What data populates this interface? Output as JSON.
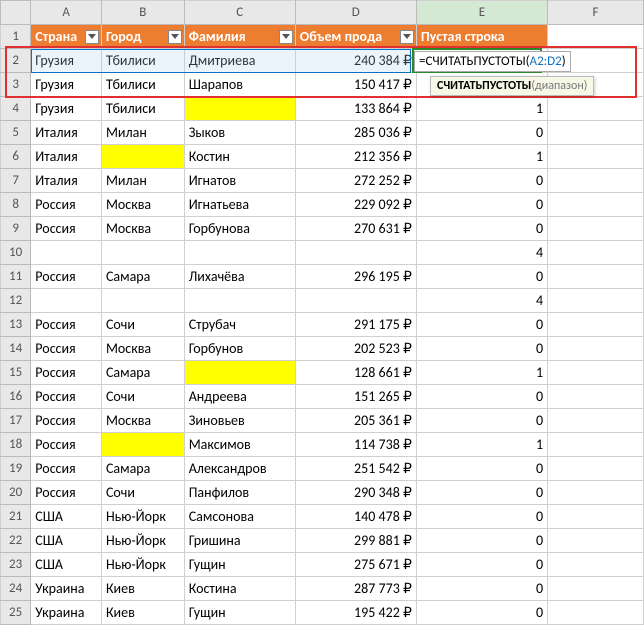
{
  "columns": [
    "A",
    "B",
    "C",
    "D",
    "E",
    "F"
  ],
  "headers": {
    "A": "Страна",
    "B": "Город",
    "C": "Фамилия",
    "D": "Объем прода",
    "E": "Пустая строка"
  },
  "rows": [
    {
      "n": 2,
      "A": "Грузия",
      "B": "Тбилиси",
      "C": "Дмитриева",
      "D": "240 384 ₽",
      "E": ""
    },
    {
      "n": 3,
      "A": "Грузия",
      "B": "Тбилиси",
      "C": "Шарапов",
      "D": "150 417 ₽",
      "E": ""
    },
    {
      "n": 4,
      "A": "Грузия",
      "B": "Тбилиси",
      "C": "",
      "D": "133 864 ₽",
      "E": "1",
      "yellow": "C"
    },
    {
      "n": 5,
      "A": "Италия",
      "B": "Милан",
      "C": "Зыков",
      "D": "285 036 ₽",
      "E": "0"
    },
    {
      "n": 6,
      "A": "Италия",
      "B": "",
      "C": "Костин",
      "D": "212 356 ₽",
      "E": "1",
      "yellow": "B"
    },
    {
      "n": 7,
      "A": "Италия",
      "B": "Милан",
      "C": "Игнатов",
      "D": "272 252 ₽",
      "E": "0"
    },
    {
      "n": 8,
      "A": "Россия",
      "B": "Москва",
      "C": "Игнатьева",
      "D": "229 092 ₽",
      "E": "0"
    },
    {
      "n": 9,
      "A": "Россия",
      "B": "Москва",
      "C": "Горбунова",
      "D": "270 631 ₽",
      "E": "0"
    },
    {
      "n": 10,
      "A": "",
      "B": "",
      "C": "",
      "D": "",
      "E": "4"
    },
    {
      "n": 11,
      "A": "Россия",
      "B": "Самара",
      "C": "Лихачёва",
      "D": "296 195 ₽",
      "E": "0"
    },
    {
      "n": 12,
      "A": "",
      "B": "",
      "C": "",
      "D": "",
      "E": "4"
    },
    {
      "n": 13,
      "A": "Россия",
      "B": "Сочи",
      "C": "Струбач",
      "D": "291 175 ₽",
      "E": "0"
    },
    {
      "n": 14,
      "A": "Россия",
      "B": "Москва",
      "C": "Горбунов",
      "D": "202 523 ₽",
      "E": "0"
    },
    {
      "n": 15,
      "A": "Россия",
      "B": "Самара",
      "C": "",
      "D": "128 661 ₽",
      "E": "1",
      "yellow": "C"
    },
    {
      "n": 16,
      "A": "Россия",
      "B": "Сочи",
      "C": "Андреева",
      "D": "151 265 ₽",
      "E": "0"
    },
    {
      "n": 17,
      "A": "Россия",
      "B": "Москва",
      "C": "Зиновьев",
      "D": "205 361 ₽",
      "E": "0"
    },
    {
      "n": 18,
      "A": "Россия",
      "B": "",
      "C": "Максимов",
      "D": "114 738 ₽",
      "E": "1",
      "yellow": "B"
    },
    {
      "n": 19,
      "A": "Россия",
      "B": "Самара",
      "C": "Александров",
      "D": "251 542 ₽",
      "E": "0"
    },
    {
      "n": 20,
      "A": "Россия",
      "B": "Сочи",
      "C": "Панфилов",
      "D": "290 348 ₽",
      "E": "0"
    },
    {
      "n": 21,
      "A": "США",
      "B": "Нью-Йорк",
      "C": "Самсонова",
      "D": "140 478 ₽",
      "E": "0"
    },
    {
      "n": 22,
      "A": "США",
      "B": "Нью-Йорк",
      "C": "Гришина",
      "D": "299 881 ₽",
      "E": "0"
    },
    {
      "n": 23,
      "A": "США",
      "B": "Нью-Йорк",
      "C": "Гущин",
      "D": "275 671 ₽",
      "E": "0"
    },
    {
      "n": 24,
      "A": "Украина",
      "B": "Киев",
      "C": "Костина",
      "D": "287 773 ₽",
      "E": "0"
    },
    {
      "n": 25,
      "A": "Украина",
      "B": "Киев",
      "C": "Гущин",
      "D": "195 422 ₽",
      "E": "0"
    }
  ],
  "formula": {
    "prefix": "=СЧИТАТЬПУСТОТЫ(",
    "ref": "A2:D2",
    "suffix": ")"
  },
  "tooltip": {
    "func": "СЧИТАТЬПУСТОТЫ",
    "arg": "(диапазон)"
  },
  "selected_col": "E",
  "chart_data": {
    "type": "table",
    "title": "Объем продаж / Пустая строка",
    "columns": [
      "Страна",
      "Город",
      "Фамилия",
      "Объем продаж",
      "Пустая строка"
    ]
  }
}
